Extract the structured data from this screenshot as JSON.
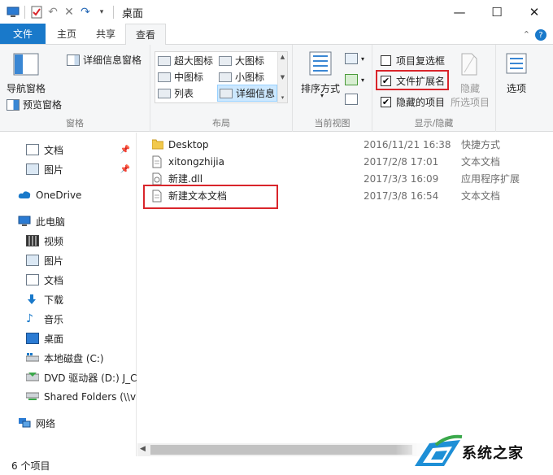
{
  "window": {
    "title": "桌面",
    "quick_access_icons": [
      "computer-icon",
      "properties-icon",
      "undo-icon",
      "delete-icon",
      "redo-icon",
      "dropdown-icon"
    ],
    "controls": [
      "minimize",
      "maximize",
      "close"
    ]
  },
  "ribbon_tabs": [
    {
      "label": "文件"
    },
    {
      "label": "主页"
    },
    {
      "label": "共享"
    },
    {
      "label": "查看"
    }
  ],
  "ribbon": {
    "panes": {
      "nav_pane": "导航窗格",
      "preview_pane": "预览窗格",
      "details_pane": "详细信息窗格",
      "group_label": "窗格"
    },
    "layout": {
      "options": [
        "超大图标",
        "大图标",
        "中图标",
        "小图标",
        "列表",
        "详细信息"
      ],
      "selected": "详细信息",
      "group_label": "布局"
    },
    "current_view": {
      "sort_by": "排序方式",
      "group_label": "当前视图"
    },
    "show_hide": {
      "item_checkboxes": {
        "label": "项目复选框",
        "checked": false
      },
      "file_extensions": {
        "label": "文件扩展名",
        "checked": true
      },
      "hidden_items": {
        "label": "隐藏的项目",
        "checked": true
      },
      "hide_selected": "隐藏",
      "hide_selected_sub": "所选项目",
      "group_label": "显示/隐藏"
    },
    "options_label": "选项"
  },
  "nav": {
    "items": [
      {
        "label": "文档",
        "icon": "document-icon",
        "pinned": true
      },
      {
        "label": "图片",
        "icon": "picture-icon",
        "pinned": true
      },
      {
        "label": "OneDrive",
        "icon": "cloud-icon"
      },
      {
        "label": "此电脑",
        "icon": "computer-icon"
      },
      {
        "label": "视频",
        "icon": "video-icon"
      },
      {
        "label": "图片",
        "icon": "picture-icon"
      },
      {
        "label": "文档",
        "icon": "document-icon"
      },
      {
        "label": "下载",
        "icon": "download-icon"
      },
      {
        "label": "音乐",
        "icon": "music-icon"
      },
      {
        "label": "桌面",
        "icon": "desktop-icon"
      },
      {
        "label": "本地磁盘 (C:)",
        "icon": "disk-icon"
      },
      {
        "label": "DVD 驱动器 (D:) J_C",
        "icon": "dvd-icon"
      },
      {
        "label": "Shared Folders (\\\\v",
        "icon": "network-drive-icon"
      },
      {
        "label": "网络",
        "icon": "network-icon"
      }
    ]
  },
  "files": [
    {
      "name": "Desktop",
      "modified": "2016/11/21 16:38",
      "type": "快捷方式",
      "icon": "folder-shortcut-icon"
    },
    {
      "name": "xitongzhijia",
      "modified": "2017/2/8 17:01",
      "type": "文本文档",
      "icon": "text-file-icon"
    },
    {
      "name": "新建.dll",
      "modified": "2017/3/3 16:09",
      "type": "应用程序扩展",
      "icon": "dll-file-icon"
    },
    {
      "name": "新建文本文档",
      "modified": "2017/3/8 16:54",
      "type": "文本文档",
      "icon": "text-file-icon"
    }
  ],
  "status": {
    "item_count": "6 个项目"
  },
  "watermark": {
    "text": "系统之家"
  },
  "colors": {
    "accent": "#1979ca",
    "highlight_box": "#d9252b",
    "selection": "#cce8ff"
  }
}
